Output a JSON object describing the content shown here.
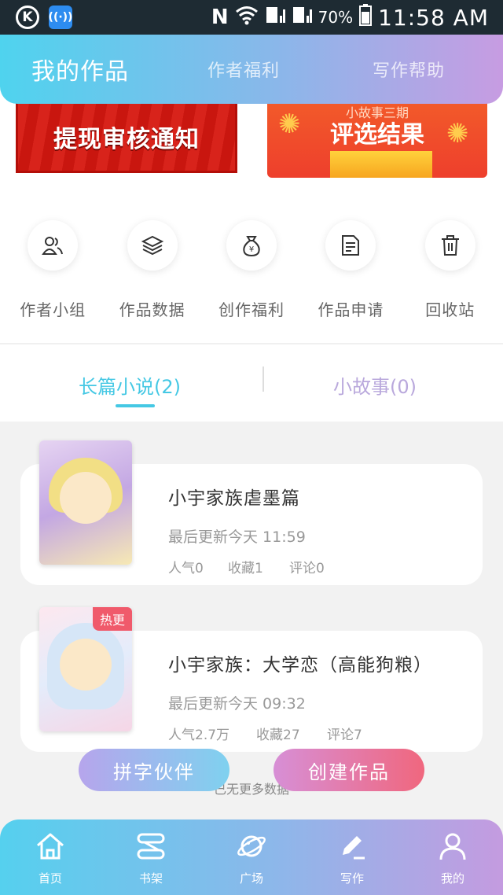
{
  "status_bar": {
    "time": "11:58 AM",
    "battery": "70%",
    "left_badge_letter": "K",
    "notification_letter": "N"
  },
  "top_tabs": {
    "active": "我的作品",
    "welfare": "作者福利",
    "help": "写作帮助"
  },
  "banners": {
    "left": "提现审核通知",
    "right_sub": "小故事三期",
    "right_main": "评选结果"
  },
  "functions": [
    {
      "label": "作者小组",
      "icon": "people-icon"
    },
    {
      "label": "作品数据",
      "icon": "layers-icon"
    },
    {
      "label": "创作福利",
      "icon": "money-bag-icon"
    },
    {
      "label": "作品申请",
      "icon": "document-icon"
    },
    {
      "label": "回收站",
      "icon": "trash-icon"
    }
  ],
  "sub_tabs": {
    "long": "长篇小说(2)",
    "short": "小故事(0)"
  },
  "works": [
    {
      "title": "小宇家族虐墨篇",
      "update": "最后更新今天 11:59",
      "popularity": "人气0",
      "favorites": "收藏1",
      "comments": "评论0"
    },
    {
      "title": "小宇家族：大学恋（高能狗粮）",
      "update": "最后更新今天 09:32",
      "popularity": "人气2.7万",
      "favorites": "收藏27",
      "comments": "评论7",
      "badge": "热更"
    }
  ],
  "buttons": {
    "partner": "拼字伙伴",
    "create": "创建作品"
  },
  "no_more": "已无更多数据",
  "bottom_nav": [
    {
      "label": "首页",
      "icon": "home-icon"
    },
    {
      "label": "书架",
      "icon": "bookshelf-icon"
    },
    {
      "label": "广场",
      "icon": "planet-icon"
    },
    {
      "label": "写作",
      "icon": "pen-icon"
    },
    {
      "label": "我的",
      "icon": "person-icon"
    }
  ],
  "colors": {
    "accent_cyan": "#45c8e4",
    "accent_purple": "#b9a8dc",
    "hot_badge": "#f05a6b"
  }
}
